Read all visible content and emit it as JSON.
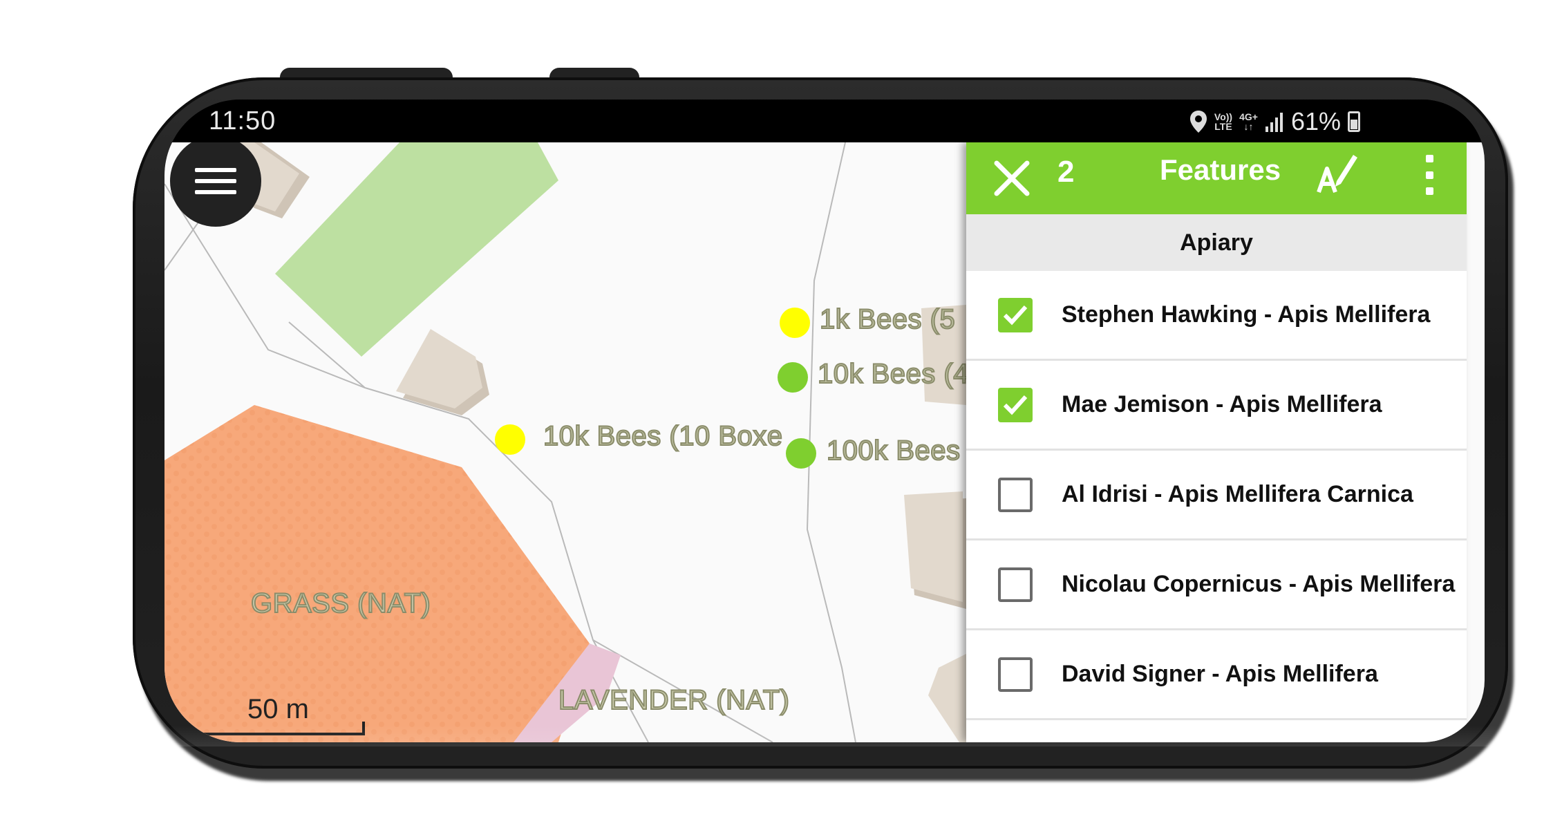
{
  "status_bar": {
    "time": "11:50",
    "volte_top": "Vo))",
    "volte_bottom": "LTE",
    "network_top": "4G+",
    "network_bottom": "↓↑",
    "battery_percent": "61%",
    "icons": [
      "location-icon",
      "signal-icon",
      "battery-icon"
    ]
  },
  "map": {
    "labels": [
      {
        "id": "bees-1k",
        "text": "1k Bees (5"
      },
      {
        "id": "bees-10k-a",
        "text": "10k Bees (4"
      },
      {
        "id": "bees-10k-boxes",
        "text": "10k Bees (10 Boxe"
      },
      {
        "id": "bees-100k",
        "text": "100k Bees"
      },
      {
        "id": "grass",
        "text": "GRASS (NAT)"
      },
      {
        "id": "lavender",
        "text": "LAVENDER (NAT)"
      }
    ],
    "points": [
      {
        "label": "1k Bees",
        "color": "#ffff00"
      },
      {
        "label": "10k Bees (4",
        "color": "#7fcf2f"
      },
      {
        "label": "10k Bees (10 Boxes)",
        "color": "#ffff00"
      },
      {
        "label": "100k Bees",
        "color": "#7fcf2f"
      }
    ],
    "scale_text": "50 m",
    "colors": {
      "grass": "#f7a87a",
      "lavender": "#e9c5d6",
      "green_area": "#bde0a1",
      "building": "#e2d9cd"
    }
  },
  "panel": {
    "selected_count": "2",
    "title": "Features",
    "section": "Apiary",
    "accent": "#7fcf2f",
    "features": [
      {
        "label": "Stephen Hawking - Apis Mellifera",
        "checked": true
      },
      {
        "label": "Mae Jemison - Apis Mellifera",
        "checked": true
      },
      {
        "label": "Al Idrisi - Apis Mellifera Carnica",
        "checked": false
      },
      {
        "label": "Nicolau Copernicus - Apis Mellifera",
        "checked": false
      },
      {
        "label": "David Signer - Apis Mellifera",
        "checked": false
      }
    ]
  }
}
